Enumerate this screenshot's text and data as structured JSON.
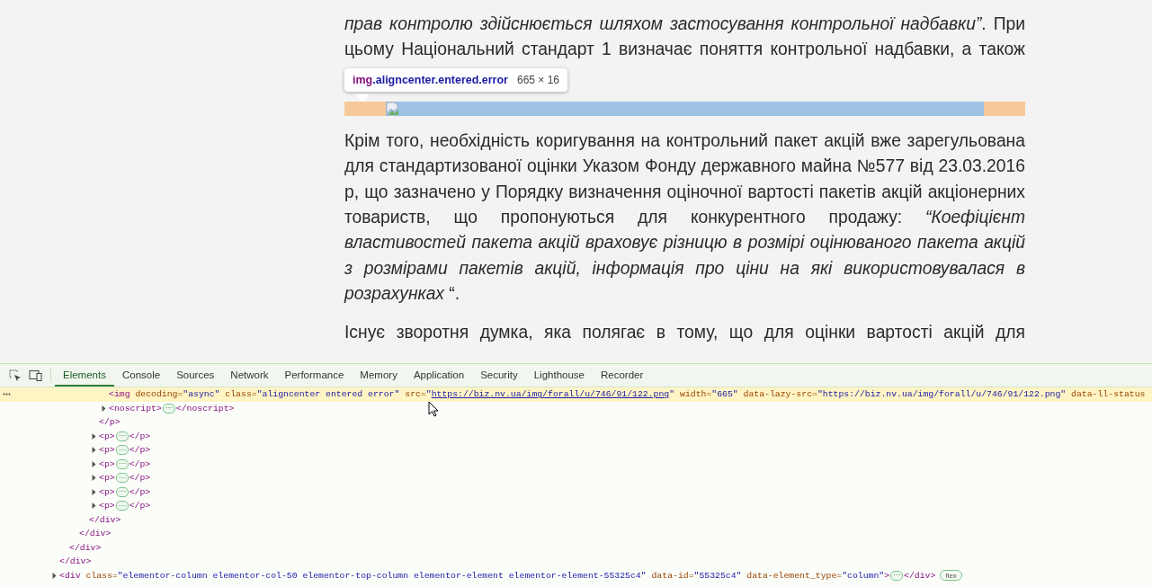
{
  "article": {
    "paragraphs_before": [
      {
        "text": "*прав контролю здійснюється шляхом застосування контрольної надбавки”*. При цьому Національний стандарт 1 визначає поняття контрольної надбавки, а також"
      }
    ],
    "highlighted_image": {
      "broken": true,
      "tooltip": {
        "tag": "img",
        "classes": ".aligncenter.entered.error",
        "size": "665 × 16"
      }
    },
    "paragraphs_after": [
      {
        "text": "Крім того, необхідність коригування на контрольний пакет акцій вже зарегульована для стандартизованої оцінки Указом Фонду державного майна №577 від 23.03.2016 р, що зазначено у Порядку визначення оціночної вартості пакетів акцій акціонерних товариств, що пропонуються для конкурентного продажу: *“Коефіцієнт властивостей пакета акцій враховує різницю в розмірі оцінюваного пакета акцій з розмірами пакетів акцій, інформація про ціни на які використовувалася в розрахунках* “."
      },
      {
        "text": "Існує зворотня думка, яка полягає в тому, що для оцінки вартості акцій для"
      }
    ]
  },
  "devtools": {
    "tabs": [
      {
        "label": "Elements",
        "selected": true
      },
      {
        "label": "Console",
        "selected": false
      },
      {
        "label": "Sources",
        "selected": false
      },
      {
        "label": "Network",
        "selected": false
      },
      {
        "label": "Performance",
        "selected": false
      },
      {
        "label": "Memory",
        "selected": false
      },
      {
        "label": "Application",
        "selected": false
      },
      {
        "label": "Security",
        "selected": false
      },
      {
        "label": "Lighthouse",
        "selected": false
      },
      {
        "label": "Recorder",
        "selected": false
      }
    ],
    "dom_tree": [
      {
        "close": [
          {
            "kind": "tag",
            "text": "</div>"
          }
        ],
        "children": [
          {
            "close": [
              {
                "kind": "tag",
                "text": "</div>"
              }
            ],
            "children": [
              {
                "close": [
                  {
                    "kind": "tag",
                    "text": "</div>"
                  }
                ],
                "children": [
                  {
                    "close": [
                      {
                        "kind": "tag",
                        "text": "</div>"
                      }
                    ],
                    "children": [
                      {
                        "close": [
                          {
                            "kind": "tag",
                            "text": "</p>"
                          }
                        ],
                        "children": [
                          {
                            "selected": true,
                            "open": [
                              {
                                "kind": "tag",
                                "text": "<img"
                              },
                              {
                                "kind": "attr",
                                "text": " decoding="
                              },
                              {
                                "kind": "value",
                                "text": "\"async\""
                              },
                              {
                                "kind": "attr",
                                "text": " class="
                              },
                              {
                                "kind": "value",
                                "text": "\"aligncenter entered error\""
                              },
                              {
                                "kind": "attr",
                                "text": " src="
                              },
                              {
                                "kind": "value",
                                "text": "\""
                              },
                              {
                                "kind": "link",
                                "text": "https://biz.nv.ua/img/forall/u/746/91/122.png"
                              },
                              {
                                "kind": "value",
                                "text": "\""
                              },
                              {
                                "kind": "attr",
                                "text": " width="
                              },
                              {
                                "kind": "value",
                                "text": "\"665\""
                              },
                              {
                                "kind": "attr",
                                "text": " data-lazy-src="
                              },
                              {
                                "kind": "value",
                                "text": "\"https://biz.nv.ua/img/forall/u/746/91/122.png\""
                              },
                              {
                                "kind": "attr",
                                "text": " data-ll-status"
                              }
                            ]
                          },
                          {
                            "selected": false,
                            "expanded": false,
                            "open": [
                              {
                                "kind": "tag",
                                "text": "<noscript>"
                              },
                              {
                                "kind": "more",
                                "text": "⋯"
                              },
                              {
                                "kind": "tag",
                                "text": "</noscript>"
                              }
                            ]
                          }
                        ]
                      },
                      {
                        "selected": false,
                        "expanded": false,
                        "open": [
                          {
                            "kind": "tag",
                            "text": "<p>"
                          },
                          {
                            "kind": "more",
                            "text": "⋯"
                          },
                          {
                            "kind": "tag",
                            "text": "</p>"
                          }
                        ]
                      },
                      {
                        "selected": false,
                        "expanded": false,
                        "open": [
                          {
                            "kind": "tag",
                            "text": "<p>"
                          },
                          {
                            "kind": "more",
                            "text": "⋯"
                          },
                          {
                            "kind": "tag",
                            "text": "</p>"
                          }
                        ]
                      },
                      {
                        "selected": false,
                        "expanded": false,
                        "open": [
                          {
                            "kind": "tag",
                            "text": "<p>"
                          },
                          {
                            "kind": "more",
                            "text": "⋯"
                          },
                          {
                            "kind": "tag",
                            "text": "</p>"
                          }
                        ]
                      },
                      {
                        "selected": false,
                        "expanded": false,
                        "open": [
                          {
                            "kind": "tag",
                            "text": "<p>"
                          },
                          {
                            "kind": "more",
                            "text": "⋯"
                          },
                          {
                            "kind": "tag",
                            "text": "</p>"
                          }
                        ]
                      },
                      {
                        "selected": false,
                        "expanded": false,
                        "open": [
                          {
                            "kind": "tag",
                            "text": "<p>"
                          },
                          {
                            "kind": "more",
                            "text": "⋯"
                          },
                          {
                            "kind": "tag",
                            "text": "</p>"
                          }
                        ]
                      },
                      {
                        "selected": false,
                        "expanded": false,
                        "open": [
                          {
                            "kind": "tag",
                            "text": "<p>"
                          },
                          {
                            "kind": "more",
                            "text": "⋯"
                          },
                          {
                            "kind": "tag",
                            "text": "</p>"
                          }
                        ]
                      }
                    ]
                  }
                ]
              }
            ]
          }
        ]
      },
      {
        "selected": false,
        "expanded": false,
        "open": [
          {
            "kind": "tag",
            "text": "<div"
          },
          {
            "kind": "attr",
            "text": " class="
          },
          {
            "kind": "value",
            "text": "\"elementor-column elementor-col-50 elementor-top-column elementor-element elementor-element-55325c4\""
          },
          {
            "kind": "attr",
            "text": " data-id="
          },
          {
            "kind": "value",
            "text": "\"55325c4\""
          },
          {
            "kind": "attr",
            "text": " data-element_type="
          },
          {
            "kind": "value",
            "text": "\"column\""
          },
          {
            "kind": "tag",
            "text": ">"
          },
          {
            "kind": "more",
            "text": "⋯"
          },
          {
            "kind": "tag",
            "text": "</div>"
          },
          {
            "kind": "badge",
            "text": "flex"
          }
        ]
      }
    ]
  }
}
